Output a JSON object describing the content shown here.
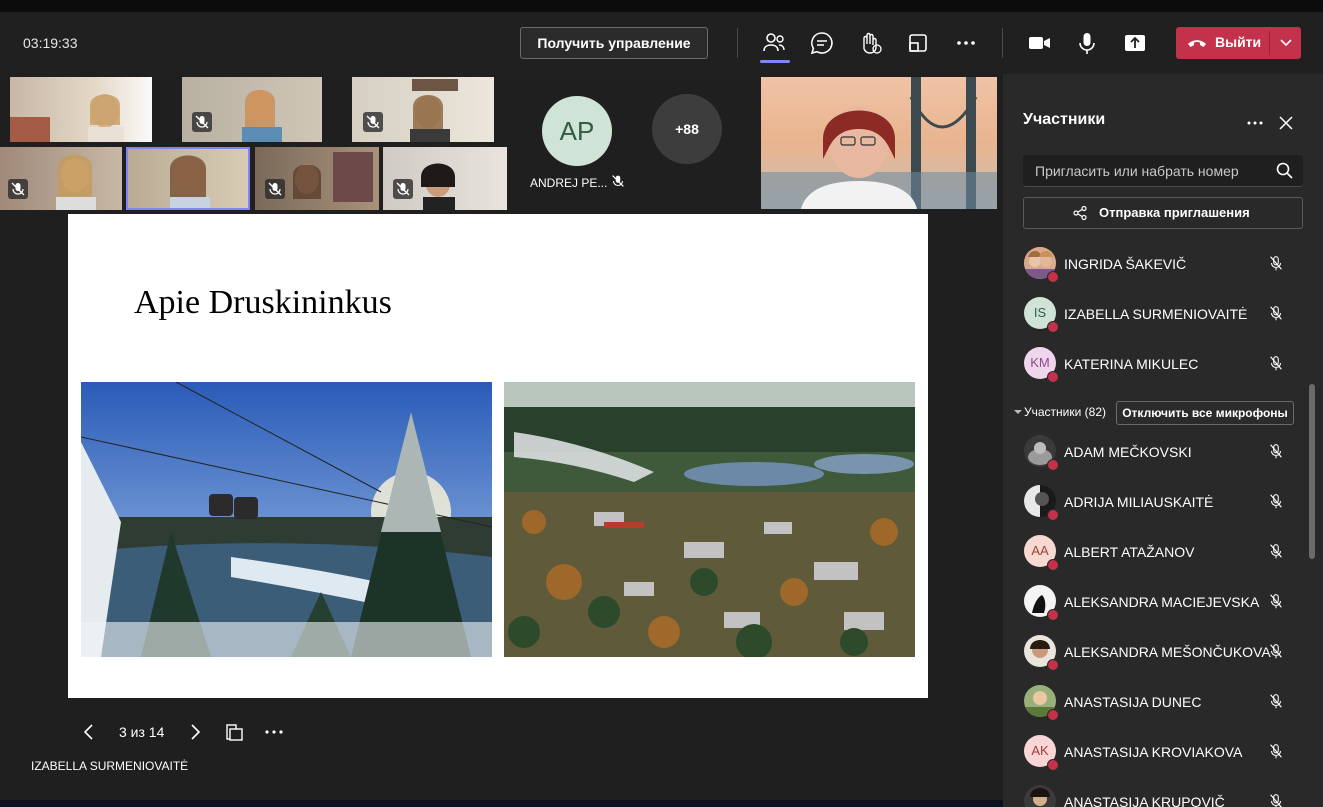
{
  "toolbar": {
    "timer": "03:19:33",
    "take_control_label": "Получить управление",
    "leave_label": "Выйти",
    "icons": [
      "participants-icon",
      "chat-icon",
      "raise-hand-icon",
      "rooms-icon",
      "more-icon",
      "camera-icon",
      "microphone-icon",
      "share-icon"
    ]
  },
  "gallery": {
    "ap_initials": "AP",
    "ap_name": "ANDREJ PE...",
    "more_count": "+88"
  },
  "slide": {
    "title": "Apie Druskininkus",
    "images": [
      "cable-car-winter-photo",
      "aerial-town-photo"
    ]
  },
  "pager": {
    "label": "3 из 14"
  },
  "presenter_name": "IZABELLA SURMENIOVAITĖ",
  "panel": {
    "title": "Участники",
    "invite_placeholder": "Пригласить или набрать номер",
    "send_invite_label": "Отправка приглашения",
    "section_label": "Участники (82)",
    "mute_all_label": "Отключить все микрофоны",
    "presenters": [
      {
        "name": "INGRIDA ŠAKEVIČ",
        "initials": ""
      },
      {
        "name": "IZABELLA SURMENIOVAITĖ",
        "initials": "IS"
      },
      {
        "name": "KATERINA MIKULEC",
        "initials": "KM"
      }
    ],
    "attendees": [
      {
        "name": "ADAM MEČKOVSKI",
        "initials": ""
      },
      {
        "name": "ADRIJA MILIAUSKAITĖ",
        "initials": ""
      },
      {
        "name": "ALBERT ATAŽANOV",
        "initials": "AA"
      },
      {
        "name": "ALEKSANDRA MACIEJEVSKA",
        "initials": ""
      },
      {
        "name": "ALEKSANDRA MEŠONČUKOVA",
        "initials": ""
      },
      {
        "name": "ANASTASIJA DUNEC",
        "initials": ""
      },
      {
        "name": "ANASTASIJA KROVIAKOVA",
        "initials": "AK"
      },
      {
        "name": "ANASTASIJA KRUPOVIČ",
        "initials": ""
      }
    ]
  },
  "colors": {
    "accent": "#7f85f5",
    "leave": "#c4314b",
    "panel_bg": "#292929",
    "stage_bg": "#1f1f1f"
  }
}
